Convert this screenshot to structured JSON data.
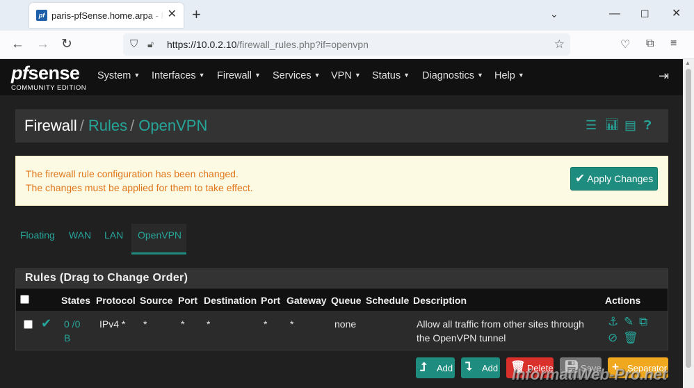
{
  "browser": {
    "tab_title": "paris-pfSense.home.arpa - Firewall: Rules: OpenVPN",
    "favicon_text": "pf",
    "url_host": "https://10.0.2.10",
    "url_path": "/firewall_rules.php?if=openvpn"
  },
  "logo": {
    "pf": "pf",
    "sense": "sense",
    "edition": "COMMUNITY EDITION"
  },
  "menu": [
    "System",
    "Interfaces",
    "Firewall",
    "Services",
    "VPN",
    "Status",
    "Diagnostics",
    "Help"
  ],
  "breadcrumb": {
    "root": "Firewall",
    "sep": "/",
    "level2": "Rules",
    "level3": "OpenVPN"
  },
  "alert": {
    "line1": "The firewall rule configuration has been changed.",
    "line2": "The changes must be applied for them to take effect.",
    "apply_label": "Apply Changes"
  },
  "tabs": [
    "Floating",
    "WAN",
    "LAN",
    "OpenVPN"
  ],
  "active_tab": "OpenVPN",
  "rules_panel": {
    "title": "Rules (Drag to Change Order)",
    "columns": [
      "States",
      "Protocol",
      "Source",
      "Port",
      "Destination",
      "Port",
      "Gateway",
      "Queue",
      "Schedule",
      "Description",
      "Actions"
    ],
    "rows": [
      {
        "states": "0 /0",
        "states_unit": "B",
        "protocol": "IPv4 *",
        "source": "*",
        "source_port": "*",
        "destination": "*",
        "destination_port": "*",
        "gateway": "*",
        "queue": "none",
        "schedule": "",
        "description_line1": "Allow all traffic from other sites through",
        "description_line2": "the OpenVPN tunnel"
      }
    ]
  },
  "buttons": {
    "add_top": "Add",
    "add_bottom": "Add",
    "delete": "Delete",
    "save": "Save",
    "separator": "Separator"
  },
  "watermark": {
    "part1": "InformatiWeb",
    "dash": "-",
    "part2": "Pro.net"
  },
  "colors": {
    "accent": "#26a69a",
    "apply_button": "#1e8c7e",
    "alert_text": "#e0761b",
    "delete_button": "#d9302c",
    "separator_button": "#f0a81e"
  }
}
